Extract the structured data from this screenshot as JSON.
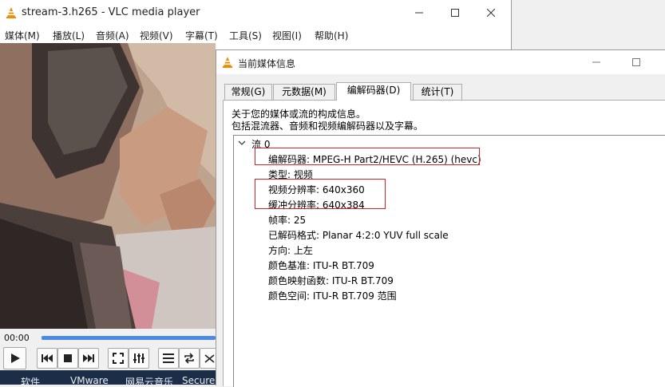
{
  "vlc": {
    "title": "stream-3.h265 - VLC media player",
    "menu": [
      "媒体(M)",
      "播放(L)",
      "音频(A)",
      "视频(V)",
      "字幕(T)",
      "工具(S)",
      "视图(I)",
      "帮助(H)"
    ],
    "time_elapsed": "00:00",
    "progress": 0
  },
  "taskbar": [
    "软件",
    "VMware",
    "网易云音乐",
    "Secure"
  ],
  "dialog": {
    "title": "当前媒体信息",
    "tabs": [
      "常规(G)",
      "元数据(M)",
      "编解码器(D)",
      "统计(T)"
    ],
    "active_tab": 2,
    "description_line1": "关于您的媒体或流的构成信息。",
    "description_line2": "包括混流器、音频和视频编解码器以及字幕。",
    "stream": {
      "name": "流 0",
      "rows": [
        "编解码器: MPEG-H Part2/HEVC (H.265) (hevc)",
        "类型: 视频",
        "视频分辨率: 640x360",
        "缓冲分辨率: 640x384",
        "帧率: 25",
        "已解码格式: Planar 4:2:0 YUV full scale",
        "方向: 上左",
        "颜色基准: ITU-R BT.709",
        "颜色映射函数: ITU-R BT.709",
        "颜色空间: ITU-R BT.709 范围"
      ]
    }
  },
  "colors": {
    "highlight": "#d2232a",
    "seek_fill": "#4b8be6",
    "taskbar": "#1c2e47"
  }
}
